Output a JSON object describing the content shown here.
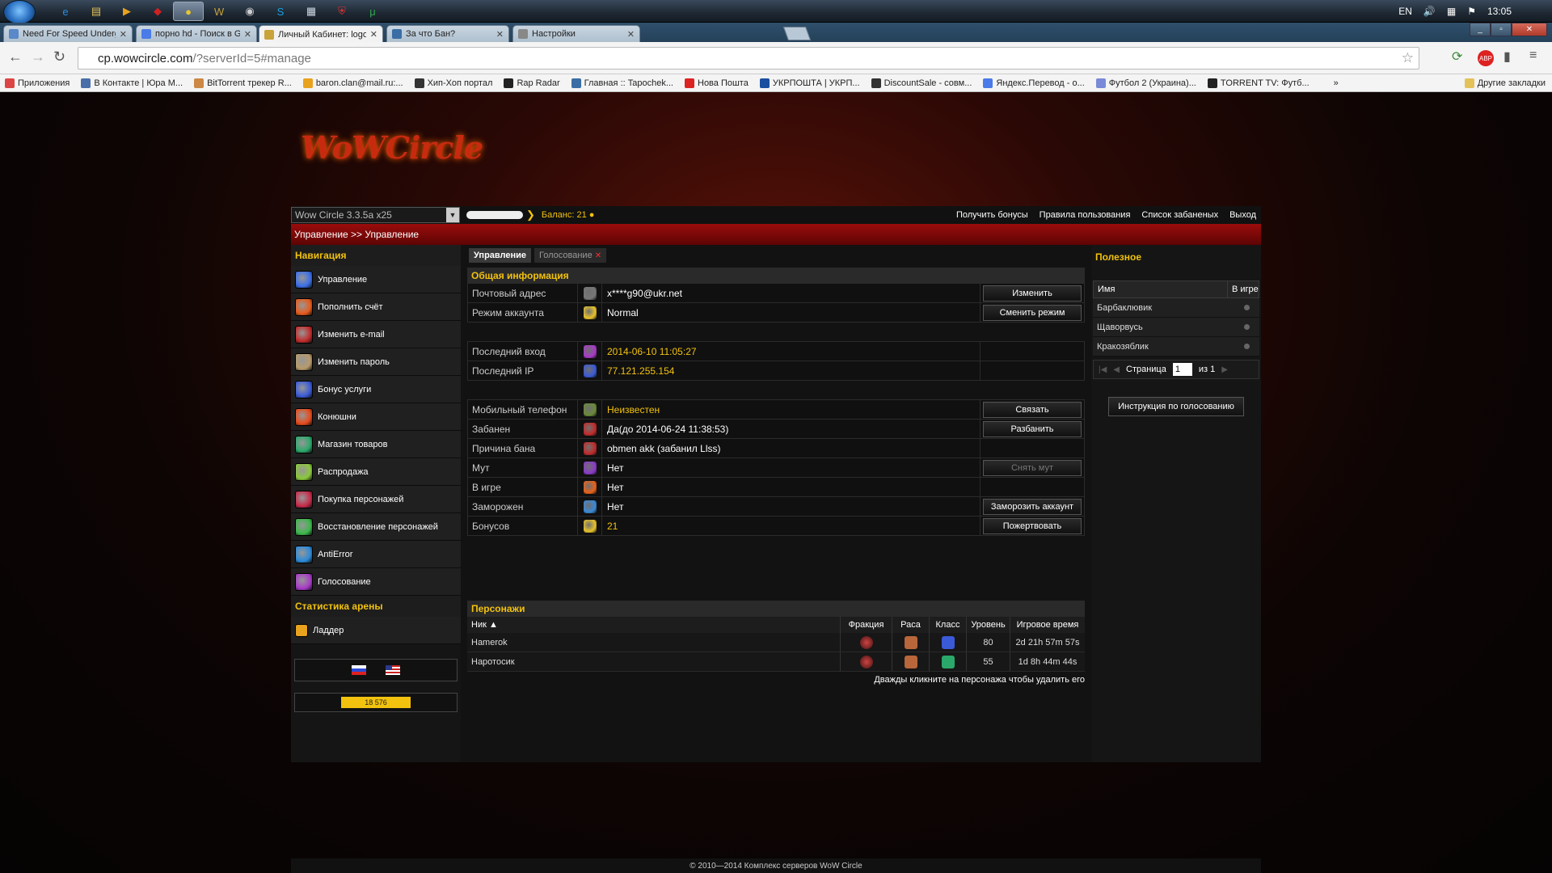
{
  "taskbar": {
    "apps": [
      {
        "name": "ie",
        "glyph": "e",
        "color": "#2b8de0"
      },
      {
        "name": "explorer",
        "glyph": "▤",
        "color": "#e4c25a"
      },
      {
        "name": "media",
        "glyph": "▶",
        "color": "#e8a21e"
      },
      {
        "name": "app-red",
        "glyph": "◆",
        "color": "#c22"
      },
      {
        "name": "chrome",
        "glyph": "●",
        "color": "#e8c82a"
      },
      {
        "name": "wow",
        "glyph": "W",
        "color": "#c9a23a"
      },
      {
        "name": "steam",
        "glyph": "◉",
        "color": "#ccc"
      },
      {
        "name": "skype",
        "glyph": "S",
        "color": "#1aa0e0"
      },
      {
        "name": "notepad",
        "glyph": "▦",
        "color": "#cfd8e2"
      },
      {
        "name": "shield",
        "glyph": "⛨",
        "color": "#d33"
      },
      {
        "name": "utorrent",
        "glyph": "μ",
        "color": "#2ea84a"
      }
    ],
    "lang": "EN",
    "time": "13:05"
  },
  "browser": {
    "tabs": [
      {
        "title": "Need For Speed Undergro",
        "color": "#5a88c8"
      },
      {
        "title": "порно hd - Поиск в Goog",
        "color": "#4a7be8"
      },
      {
        "title": "Личный Кабинет: logon.",
        "color": "#c9a23a",
        "active": true
      },
      {
        "title": "За что Бан?",
        "color": "#3a6ea5"
      },
      {
        "title": "Настройки",
        "color": "#888"
      }
    ],
    "url_host": "cp.wowcircle.com",
    "url_path": "/?serverId=5#manage",
    "bookmarks": [
      {
        "label": "Приложения",
        "color": "#d44"
      },
      {
        "label": "В Контакте | Юра М...",
        "color": "#4a6ea8"
      },
      {
        "label": "BitTorrent трекер R...",
        "color": "#c84"
      },
      {
        "label": "baron.clan@mail.ru:...",
        "color": "#e8a21e"
      },
      {
        "label": "Хип-Хоп портал",
        "color": "#333"
      },
      {
        "label": "Rap Radar",
        "color": "#222"
      },
      {
        "label": "Главная :: Tapochek...",
        "color": "#3a6ea5"
      },
      {
        "label": "Нова Пошта",
        "color": "#d22"
      },
      {
        "label": "УКРПОШТА | УКРП...",
        "color": "#1a4fa0"
      },
      {
        "label": "DiscountSale - совм...",
        "color": "#333"
      },
      {
        "label": "Яндекс.Перевод - о...",
        "color": "#4a7be8"
      },
      {
        "label": "Футбол 2 (Украина)...",
        "color": "#7a8ad8"
      },
      {
        "label": "TORRENT TV: Футб...",
        "color": "#222"
      },
      {
        "label": "»",
        "color": "transparent"
      },
      {
        "label": "Другие закладки",
        "color": "#e4c25a"
      }
    ]
  },
  "site": {
    "logo_text": "WoWCircle",
    "server": "Wow Circle 3.3.5a x25",
    "balance_label": "Баланс:",
    "balance_value": "21",
    "top_links": [
      "Получить бонусы",
      "Правила пользования",
      "Список забаненых",
      "Выход"
    ],
    "breadcrumb": "Управление >> Управление",
    "footer": "© 2010—2014 Комплекс серверов WoW Circle"
  },
  "sidebar": {
    "nav_title": "Навигация",
    "items": [
      {
        "label": "Управление",
        "color": "#3a6ee8"
      },
      {
        "label": "Пополнить счёт",
        "color": "#e85a1a"
      },
      {
        "label": "Изменить e-mail",
        "color": "#c22a2a"
      },
      {
        "label": "Изменить пароль",
        "color": "#b89a6a"
      },
      {
        "label": "Бонус услуги",
        "color": "#3a5ad8"
      },
      {
        "label": "Конюшни",
        "color": "#e84a1a"
      },
      {
        "label": "Магазин товаров",
        "color": "#2aa86a"
      },
      {
        "label": "Распродажа",
        "color": "#8ac83a"
      },
      {
        "label": "Покупка персонажей",
        "color": "#c82a4a"
      },
      {
        "label": "Восстановление персонажей",
        "color": "#3ab84a"
      },
      {
        "label": "AntiError",
        "color": "#2a8ad8"
      },
      {
        "label": "Голосование",
        "color": "#a83ac8"
      }
    ],
    "arena_title": "Статистика арены",
    "arena_items": [
      {
        "label": "Ладдер",
        "color": "#e8a21e"
      }
    ],
    "badge_text": "18 576"
  },
  "main": {
    "tabs": [
      {
        "label": "Управление",
        "active": true
      },
      {
        "label": "Голосование",
        "closable": true
      }
    ],
    "info_title": "Общая информация",
    "group1": [
      {
        "label": "Почтовый адрес",
        "value": "x****g90@ukr.net",
        "button": "Изменить",
        "icon_color": "#777"
      },
      {
        "label": "Режим аккаунта",
        "value": "Normal",
        "button": "Сменить режим",
        "icon_color": "#e8c22a"
      }
    ],
    "group2": [
      {
        "label": "Последний вход",
        "value": "2014-06-10 11:05:27",
        "icon_color": "#a83ac8"
      },
      {
        "label": "Последний IP",
        "value": "77.121.255.154",
        "icon_color": "#3a5ad8"
      }
    ],
    "group3": [
      {
        "label": "Мобильный телефон",
        "value": "Неизвестен",
        "button": "Связать",
        "icon_color": "#6a8a3a",
        "yellow": true
      },
      {
        "label": "Забанен",
        "value": "Да(до 2014-06-24 11:38:53)",
        "button": "Разбанить",
        "icon_color": "#c22a2a"
      },
      {
        "label": "Причина бана",
        "value": "obmen akk (забанил Llss)",
        "icon_color": "#c22a2a"
      },
      {
        "label": "Мут",
        "value": "Нет",
        "button": "Снять мут",
        "disabled": true,
        "icon_color": "#8a3ac8"
      },
      {
        "label": "В игре",
        "value": "Нет",
        "icon_color": "#e8621a"
      },
      {
        "label": "Заморожен",
        "value": "Нет",
        "button": "Заморозить аккаунт",
        "icon_color": "#3a8ad8"
      },
      {
        "label": "Бонусов",
        "value": "21",
        "button": "Пожертвовать",
        "icon_color": "#e8c22a",
        "yellow": true
      }
    ],
    "chars_title": "Персонажи",
    "chars_headers": [
      "Ник ▲",
      "Фракция",
      "Раса",
      "Класс",
      "Уровень",
      "Игровое время"
    ],
    "chars": [
      {
        "name": "Hamerok",
        "level": "80",
        "time": "2d 21h 57m 57s",
        "class_color": "#3a5ad8"
      },
      {
        "name": "Наротосик",
        "level": "55",
        "time": "1d 8h 44m 44s",
        "class_color": "#2aa86a"
      }
    ],
    "chars_hint": "Дважды кликните на персонажа чтобы удалить его"
  },
  "right": {
    "title": "Полезное",
    "headers": [
      "Имя",
      "В игре"
    ],
    "rows": [
      "Барбаклювик",
      "Щаворвусь",
      "Кракозяблик"
    ],
    "page_label": "Страница",
    "page_value": "1",
    "page_of": "из 1",
    "vote_button": "Инструкция по голосованию"
  }
}
